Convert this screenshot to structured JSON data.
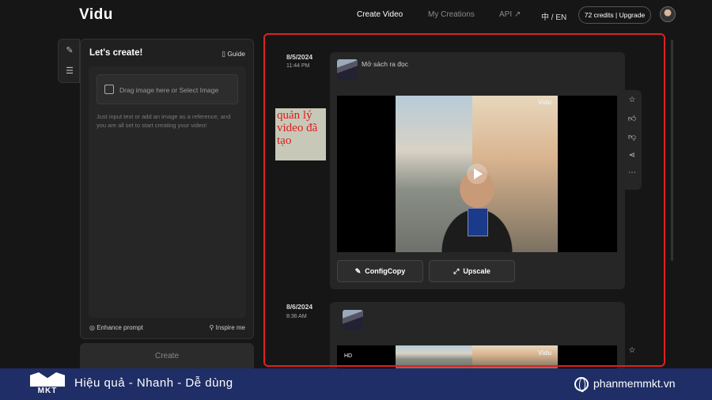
{
  "app": {
    "logo": "Vidu"
  },
  "nav": {
    "create_video": "Create Video",
    "my_creations": "My Creations",
    "api": "API ↗",
    "lang": "中 / EN",
    "credits": "72 credits | Upgrade"
  },
  "panel": {
    "title": "Let's create!",
    "guide": "Guide",
    "drop_text": "Drag image here or Select Image",
    "hint": "Just input text or add an image as a reference, and you are all set to start creating your video!",
    "enhance": "Enhance prompt",
    "inspire": "Inspire me",
    "create": "Create"
  },
  "creations": [
    {
      "date": "8/5/2024",
      "time": "11:44 PM",
      "prompt": "Mở sách ra đọc",
      "watermark": "Vidu",
      "config_copy": "ConfigCopy",
      "upscale": "Upscale"
    },
    {
      "date": "8/6/2024",
      "time": "8:36 AM",
      "quality": "HD",
      "watermark": "Vidu"
    }
  ],
  "annotation": "quản lý video đã tạo",
  "banner": {
    "logo_text": "MKT",
    "slogan": "Hiệu quả - Nhanh - Dễ dùng",
    "site": "phanmemmkt.vn"
  },
  "colors": {
    "accent_frame": "#e02020",
    "banner_bg": "#1f2e66"
  }
}
